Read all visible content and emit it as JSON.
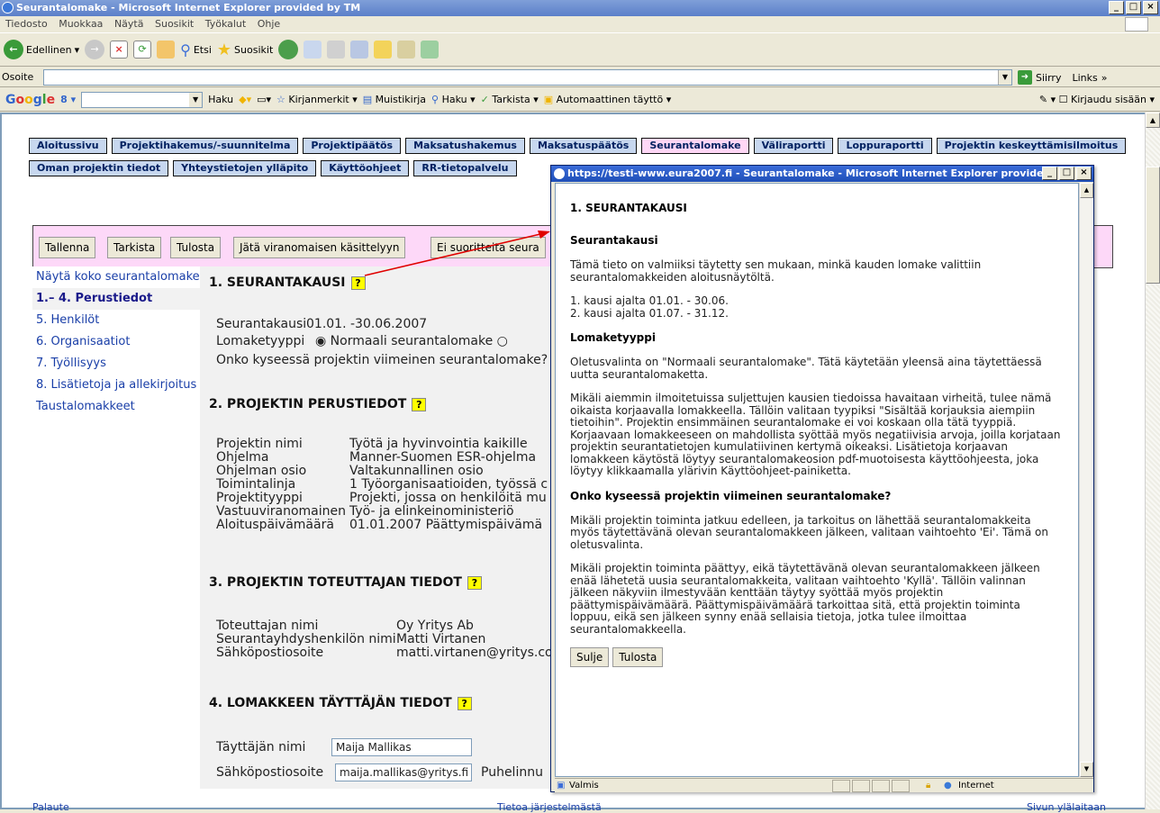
{
  "window": {
    "title": "Seurantalomake - Microsoft Internet Explorer provided by TM",
    "controls": [
      "_",
      "□",
      "×"
    ]
  },
  "menu": [
    "Tiedosto",
    "Muokkaa",
    "Näytä",
    "Suosikit",
    "Työkalut",
    "Ohje"
  ],
  "toolbar": {
    "back": "Edellinen",
    "search": "Etsi",
    "favorites": "Suosikit"
  },
  "address": {
    "label": "Osoite",
    "value": "",
    "go": "Siirry",
    "links": "Links"
  },
  "googlebar": {
    "logo": "Google",
    "search_btn": "Haku",
    "bookmarks": "Kirjanmerkit",
    "notebook": "Muistikirja",
    "search2": "Haku",
    "spellcheck": "Tarkista",
    "autofill": "Automaattinen täyttö",
    "signin": "Kirjaudu sisään"
  },
  "nav": {
    "row1": [
      "Aloitussivu",
      "Projektihakemus/-suunnitelma",
      "Projektipäätös",
      "Maksatushakemus",
      "Maksatuspäätös",
      "Seurantalomake",
      "Väliraportti",
      "Loppuraportti",
      "Projektin keskeyttämisilmoitus"
    ],
    "row2": [
      "Oman projektin tiedot",
      "Yhteystietojen ylläpito",
      "Käyttöohjeet",
      "RR-tietopalvelu"
    ],
    "active": "Seurantalomake"
  },
  "actions": [
    "Tallenna",
    "Tarkista",
    "Tulosta",
    "Jätä viranomaisen käsittelyyn",
    "Ei suoritteita seura"
  ],
  "leftnav": [
    "Näytä koko seurantalomake",
    "1.– 4. Perustiedot",
    "5. Henkilöt",
    "6. Organisaatiot",
    "7. Työllisyys",
    "8. Lisätietoja ja allekirjoitus",
    "Taustalomakkeet"
  ],
  "form": {
    "help": "?",
    "s1": {
      "title": "1. SEURANTAKAUSI",
      "period_label": "Seurantakausi",
      "period_value": "01.01. -30.06.2007",
      "type_label": "Lomaketyyppi",
      "type_option": "Normaali seurantalomake",
      "last_question": "Onko kyseessä projektin viimeinen seurantalomake?"
    },
    "s2": {
      "title": "2. PROJEKTIN PERUSTIEDOT",
      "labels": [
        "Projektin nimi",
        "Ohjelma",
        "Ohjelman osio",
        "Toimintalinja",
        "Projektityyppi",
        "Vastuuviranomainen",
        "Aloituspäivämäärä"
      ],
      "values": [
        "Työtä ja hyvinvointia kaikille",
        "Manner-Suomen ESR-ohjelma",
        "Valtakunnallinen osio",
        "1 Työorganisaatioiden, työssä c",
        "Projekti, jossa on henkilöitä mu",
        "Työ- ja elinkeinoministeriö",
        "01.01.2007  Päättymispäivämä"
      ]
    },
    "s3": {
      "title": "3. PROJEKTIN TOTEUTTAJAN TIEDOT",
      "labels": [
        "Toteuttajan nimi",
        "Seurantayhdyshenkilön nimi",
        "Sähköpostiosoite"
      ],
      "values": [
        "Oy Yritys Ab",
        "Matti Virtanen",
        "matti.virtanen@yritys.co"
      ]
    },
    "s4": {
      "title": "4. LOMAKKEEN TÄYTTÄJÄN TIEDOT",
      "name_label": "Täyttäjän nimi",
      "name_value": "Maija Mallikas",
      "email_label": "Sähköpostiosoite",
      "email_value": "maija.mallikas@yritys.fi",
      "phone_label": "Puhelinnu"
    }
  },
  "footer": {
    "feedback": "Palaute",
    "about": "Tietoa järjestelmästä",
    "top": "Sivun ylälaitaan"
  },
  "popup": {
    "title": "https://testi-www.eura2007.fi - Seurantalomake - Microsoft Internet Explorer provided by TM",
    "heading": "1. SEURANTAKAUSI",
    "sub1": "Seurantakausi",
    "p1": "Tämä tieto on valmiiksi täytetty sen mukaan, minkä kauden lomake valittiin seurantalomakkeiden aloitusnäytöltä.",
    "p2a": "1. kausi ajalta 01.01. - 30.06.",
    "p2b": "2. kausi ajalta 01.07. - 31.12.",
    "sub2": "Lomaketyyppi",
    "p3": "Oletusvalinta on \"Normaali seurantalomake\". Tätä käytetään yleensä aina täytettäessä uutta seurantalomaketta.",
    "p4": "Mikäli aiemmin ilmoitetuissa suljettujen kausien tiedoissa havaitaan virheitä, tulee nämä oikaista korjaavalla lomakkeella. Tällöin valitaan tyypiksi \"Sisältää korjauksia aiempiin tietoihin\". Projektin ensimmäinen seurantalomake ei voi koskaan olla tätä tyyppiä. Korjaavaan lomakkeeseen on mahdollista syöttää myös negatiivisia arvoja, joilla korjataan projektin seurantatietojen kumulatiivinen kertymä oikeaksi. Lisätietoja korjaavan lomakkeen käytöstä löytyy seurantalomakeosion pdf-muotoisesta käyttöohjeesta, joka löytyy klikkaamalla ylärivin Käyttöohjeet-painiketta.",
    "sub3": "Onko kyseessä projektin viimeinen seurantalomake?",
    "p5": "Mikäli projektin toiminta jatkuu edelleen, ja tarkoitus on lähettää seurantalomakkeita myös täytettävänä olevan seurantalomakkeen jälkeen, valitaan vaihtoehto 'Ei'. Tämä on oletusvalinta.",
    "p6": "Mikäli projektin toiminta päättyy, eikä täytettävänä olevan seurantalomakkeen jälkeen enää lähetetä uusia seurantalomakkeita, valitaan vaihtoehto 'Kyllä'. Tällöin valinnan jälkeen näkyviin ilmestyvään kenttään täytyy syöttää myös projektin päättymispäivämäärä. Päättymispäivämäärä tarkoittaa sitä, että projektin toiminta loppuu, eikä sen jälkeen synny enää sellaisia tietoja, jotka tulee ilmoittaa seurantalomakkeella.",
    "close": "Sulje",
    "print": "Tulosta",
    "status": "Valmis",
    "zone": "Internet"
  }
}
